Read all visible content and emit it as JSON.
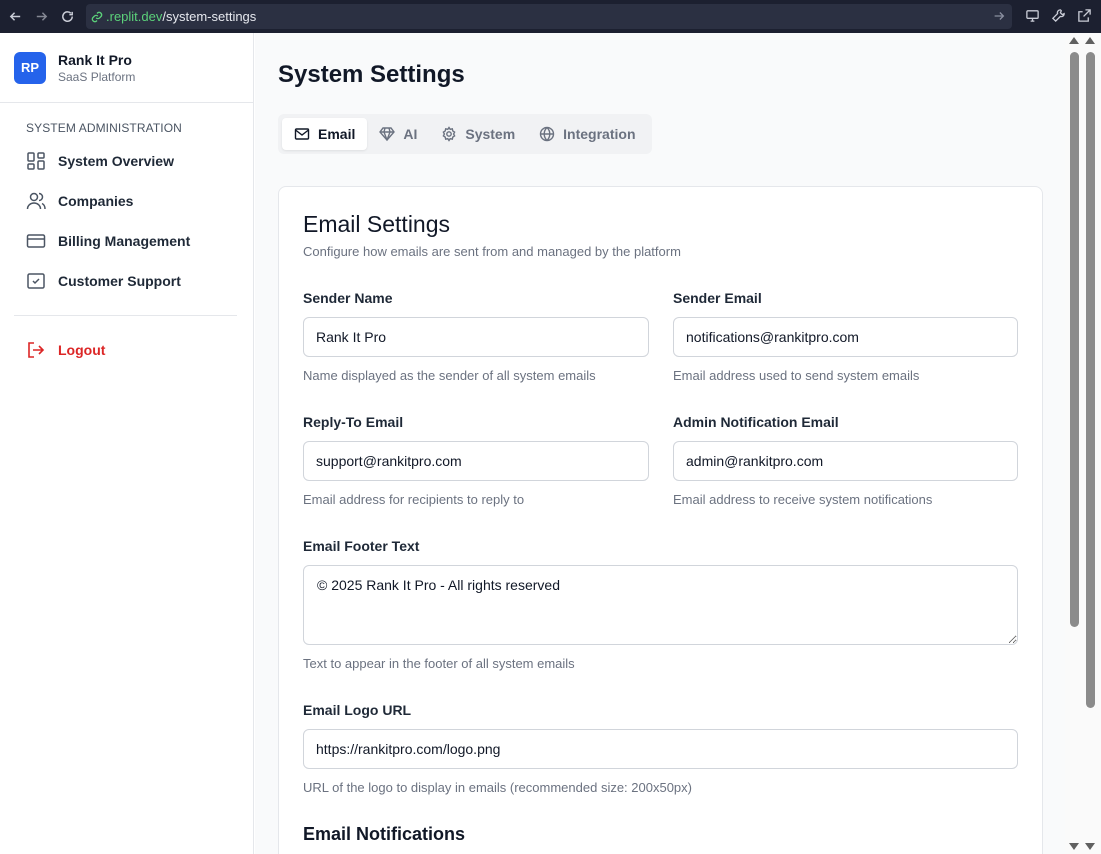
{
  "browser": {
    "url_host": ".replit.dev",
    "url_path": "/system-settings"
  },
  "sidebar": {
    "brand_initials": "RP",
    "brand_name": "Rank It Pro",
    "brand_subtitle": "SaaS Platform",
    "section_title": "SYSTEM ADMINISTRATION",
    "items": [
      {
        "label": "System Overview",
        "icon": "grid-icon"
      },
      {
        "label": "Companies",
        "icon": "users-icon"
      },
      {
        "label": "Billing Management",
        "icon": "credit-card-icon"
      },
      {
        "label": "Customer Support",
        "icon": "check-square-icon"
      }
    ],
    "logout_label": "Logout"
  },
  "main": {
    "title": "System Settings",
    "tabs": [
      {
        "label": "Email",
        "icon": "mail-icon",
        "active": true
      },
      {
        "label": "AI",
        "icon": "diamond-icon",
        "active": false
      },
      {
        "label": "System",
        "icon": "gear-icon",
        "active": false
      },
      {
        "label": "Integration",
        "icon": "globe-icon",
        "active": false
      }
    ],
    "card": {
      "title": "Email Settings",
      "description": "Configure how emails are sent from and managed by the platform",
      "fields": {
        "sender_name": {
          "label": "Sender Name",
          "value": "Rank It Pro",
          "help": "Name displayed as the sender of all system emails"
        },
        "sender_email": {
          "label": "Sender Email",
          "value": "notifications@rankitpro.com",
          "help": "Email address used to send system emails"
        },
        "reply_to": {
          "label": "Reply-To Email",
          "value": "support@rankitpro.com",
          "help": "Email address for recipients to reply to"
        },
        "admin_email": {
          "label": "Admin Notification Email",
          "value": "admin@rankitpro.com",
          "help": "Email address to receive system notifications"
        },
        "footer_text": {
          "label": "Email Footer Text",
          "value": "© 2025 Rank It Pro - All rights reserved",
          "help": "Text to appear in the footer of all system emails"
        },
        "logo_url": {
          "label": "Email Logo URL",
          "value": "https://rankitpro.com/logo.png",
          "help": "URL of the logo to display in emails (recommended size: 200x50px)"
        }
      },
      "next_section_title": "Email Notifications"
    }
  },
  "colors": {
    "accent": "#2563eb",
    "danger": "#dc2626",
    "url_green": "#5bd17a"
  }
}
